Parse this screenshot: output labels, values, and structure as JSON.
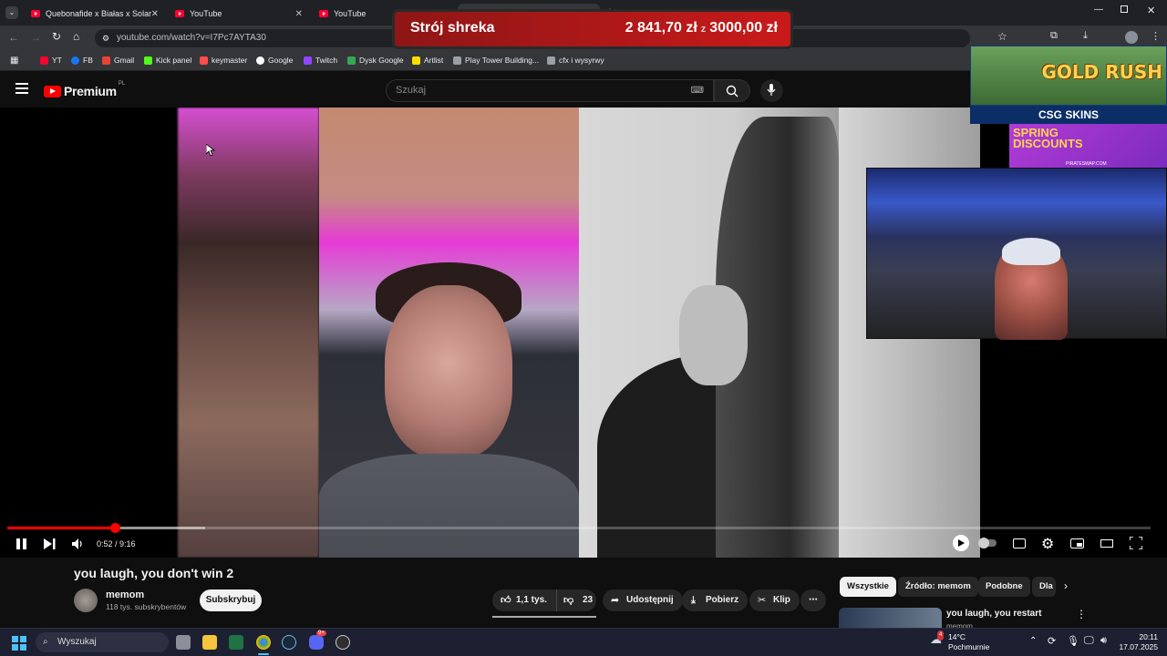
{
  "browser": {
    "tabs": [
      {
        "title": "Quebonafide x Białas x Solar - ",
        "active": false
      },
      {
        "title": "YouTube",
        "active": false
      },
      {
        "title": "YouTube",
        "active": false
      },
      {
        "title": "you laugh, you don't win 2",
        "active": true
      }
    ],
    "url": "youtube.com/watch?v=I7Pc7AYTA30",
    "bookmarks": [
      "YT",
      "FB",
      "Gmail",
      "Kick panel",
      "keymaster",
      "Google",
      "Twitch",
      "Dysk Google",
      "Artlist",
      "Play Tower Building...",
      "cfx i wysyrwy"
    ]
  },
  "overlay": {
    "goal_title": "Strój shreka",
    "goal_current": "2 841,70 zł",
    "goal_separator": "z",
    "goal_target": "3000,00 zł",
    "ad_top": "GOLD RUSH",
    "ad_brand": "CSG SKINS",
    "ad_bottom": "SPRING DISCOUNTS",
    "ad_footer": "PIRATESWAP.COM"
  },
  "youtube": {
    "logo_text": "Premium",
    "logo_region": "PL",
    "search_placeholder": "Szukaj",
    "player": {
      "time": "0:52 / 9:16",
      "progress_fraction": 0.094,
      "buffered_fraction": 0.173
    },
    "video_title": "you laugh, you don't win 2",
    "channel_name": "memom",
    "subscribers": "118 tys. subskrybentów",
    "subscribe_label": "Subskrybuj",
    "likes": "1,1 tys.",
    "dislikes": "23",
    "share_label": "Udostępnij",
    "download_label": "Pobierz",
    "clip_label": "Klip",
    "chips": [
      "Wszystkie",
      "Źródło: memom",
      "Podobne",
      "Dla"
    ],
    "recommendation_title": "you laugh, you restart",
    "recommendation_channel": "memom"
  },
  "taskbar": {
    "search_placeholder": "Wyszukaj",
    "weather_temp": "14°C",
    "weather_desc": "Pochmurnie",
    "weather_badge": "4",
    "discord_badge": "9+",
    "time": "20:11",
    "date": "17.07.2025"
  },
  "colors": {
    "youtube_red": "#ff0000",
    "goal_red": "#c91a1a",
    "background": "#0f0f0f"
  }
}
